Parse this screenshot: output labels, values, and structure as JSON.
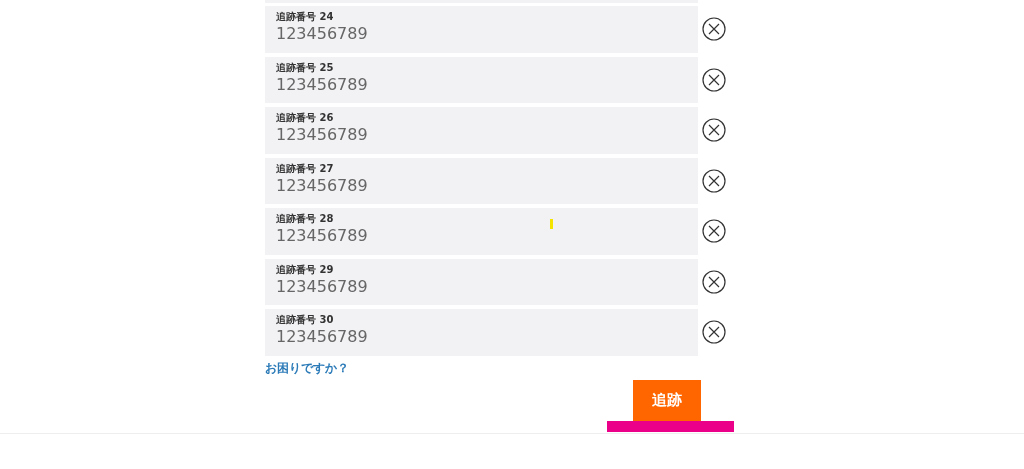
{
  "fields": [
    {
      "label": "追跡番号 24",
      "value": "123456789"
    },
    {
      "label": "追跡番号 25",
      "value": "123456789"
    },
    {
      "label": "追跡番号 26",
      "value": "123456789"
    },
    {
      "label": "追跡番号 27",
      "value": "123456789"
    },
    {
      "label": "追跡番号 28",
      "value": "123456789"
    },
    {
      "label": "追跡番号 29",
      "value": "123456789"
    },
    {
      "label": "追跡番号 30",
      "value": "123456789"
    }
  ],
  "help_link": "お困りですか？",
  "submit_button": "追跡"
}
